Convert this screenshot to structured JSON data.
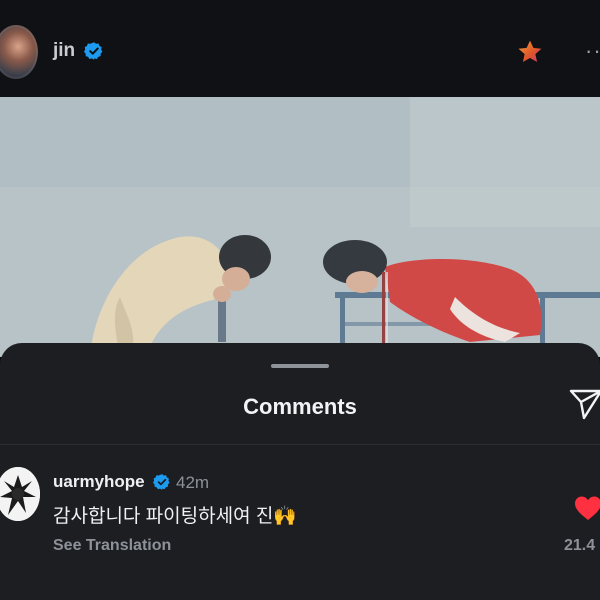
{
  "header": {
    "username": "jin",
    "more_label": "··"
  },
  "sheet": {
    "title": "Comments"
  },
  "comment": {
    "username": "uarmyhope",
    "time": "42m",
    "text": "감사합니다 파이팅하세여 진🙌",
    "translate_label": "See Translation",
    "likes": "21.4"
  },
  "colors": {
    "verified": "#1d9bf0",
    "star": "#e0582a",
    "heart": "#ff3040",
    "sheet_bg": "#1c1e22"
  }
}
